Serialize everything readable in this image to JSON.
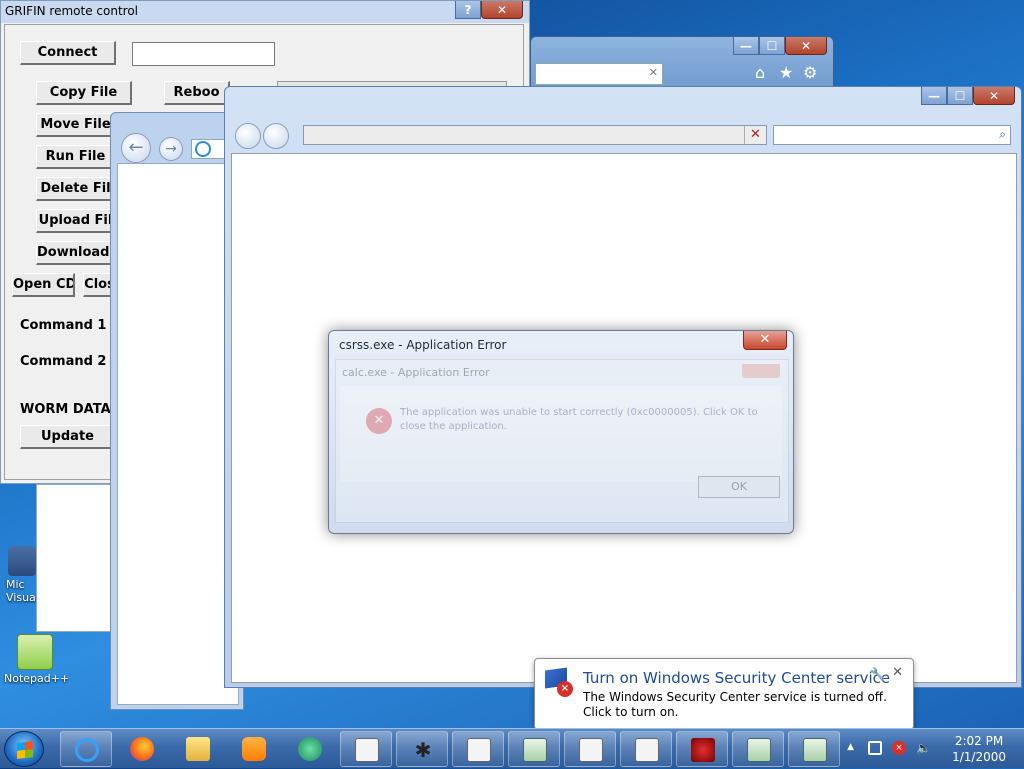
{
  "grifin": {
    "title": "GRIFIN remote control",
    "help": "?",
    "close": "✕",
    "connect": "Connect",
    "connect_input": "",
    "copy_file": "Copy File",
    "reboot": "Reboo",
    "move_file": "Move File",
    "run_file": "Run File",
    "delete_file": "Delete Fil",
    "upload_file": "Upload Fil",
    "download_file": "Download F",
    "open_cd": "Open CD",
    "close_cd": "Clos",
    "command1": "Command 1",
    "command2": "Command 2",
    "worm_data": "WORM DATA:",
    "update": "Update"
  },
  "bgwin": {
    "min": "—",
    "max": "☐",
    "close": "✕",
    "addr_x": "✕",
    "home": "⌂",
    "star": "★",
    "gear": "⚙"
  },
  "iemain": {
    "min": "—",
    "max": "☐",
    "close": "✕",
    "stop": "✕",
    "drop": "▾",
    "search_icon": "⌕"
  },
  "error_dialog": {
    "title": "csrss.exe - Application Error",
    "close": "✕",
    "ghost_title": "calc.exe - Application Error",
    "ghost_message": "The application was unable to start correctly (0xc0000005). Click OK to close the application.",
    "ghost_ok": "OK",
    "ghost_icon": "✕"
  },
  "balloon": {
    "title": "Turn on Windows Security Center service",
    "message": "The Windows Security Center service is turned off. Click to turn on.",
    "options": "🔧",
    "close": "✕"
  },
  "desktop": {
    "icon1_label": "Mic Visua",
    "icon2_label": "Notepad++"
  },
  "taskbar": {
    "time": "2:02 PM",
    "date": "1/1/2000",
    "show_hidden": "▲"
  }
}
